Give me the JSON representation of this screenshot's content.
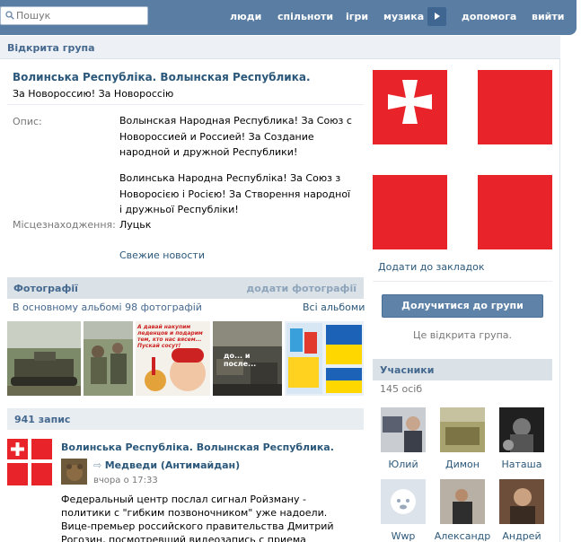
{
  "header": {
    "search_placeholder": "Пошук",
    "nav": [
      "люди",
      "спільноти",
      "ігри",
      "музика",
      "допомога",
      "вийти"
    ]
  },
  "breadcrumb": "Відкрита група",
  "group": {
    "name": "Волинська Республіка. Волынская Республика.",
    "status": "За Новороссию! За Новороссію",
    "desc_label": "Опис:",
    "desc_ru": "Волынская Народная Республика! За Союз с Новороссией и Россией! За Создание народной и дружной Республики!",
    "desc_ua": "Волинська Народна Республіка! За Союз з Новоросією і Росією! За Створення народної і дружньої Республіки!",
    "location_label": "Місцезнаходження:",
    "location": "Луцьк",
    "news_link": "Свежие новости"
  },
  "photos": {
    "title": "Фотографії",
    "add_link": "додати фотографії",
    "meta": "В основному альбомі 98 фотографій",
    "all_albums": "Всі альбоми",
    "thumb3_caption": "А давай накупим леденцов и подарим тем, кто нас вясем... Пускай сосут!",
    "thumb4_caption": "до... и после..."
  },
  "records": {
    "title": "941 запис"
  },
  "post": {
    "author": "Волинська Республіка. Волынская Республика.",
    "repost_name": "Медведи (Антимайдан)",
    "repost_time": "вчора о 17:33",
    "text": "Федеральный центр послал сигнал Ройзману - политики с \"гибким позвоночником\" уже надоели. Вице-премьер российского правительства Дмитрий Рогозин, посмотревший видеозапись с приема генконсульства США в"
  },
  "sidebar": {
    "bookmark": "Додати до закладок",
    "join_button": "Долучитися до групи",
    "open_group": "Це відкрита група.",
    "members_title": "Учасники",
    "members_count": "145 осіб",
    "members": [
      "Юлий",
      "Димон",
      "Наташа",
      "Wwp",
      "Александр",
      "Андрей"
    ]
  },
  "colors": {
    "header_bg": "#597da3",
    "flag_red": "#e8242a",
    "link": "#2b587a",
    "accent": "#45688e"
  }
}
